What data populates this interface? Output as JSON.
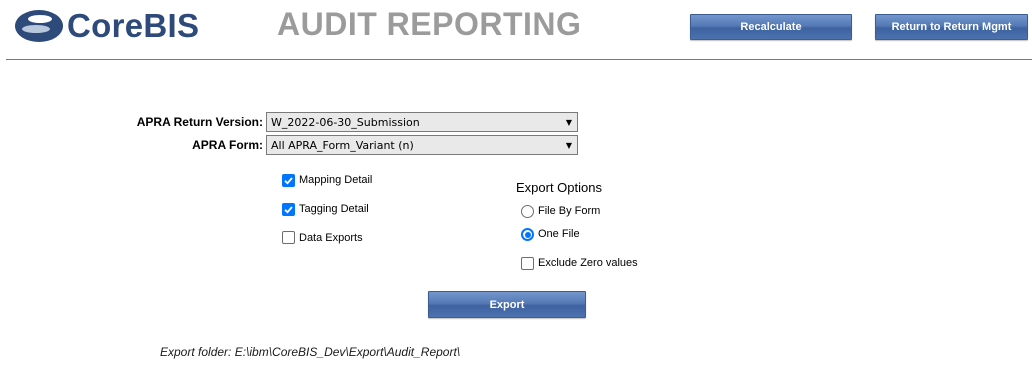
{
  "header": {
    "logo_text": "CoreBIS",
    "page_title": "AUDIT REPORTING",
    "recalculate_label": "Recalculate",
    "return_label": "Return to Return Mgmt"
  },
  "form": {
    "version_label": "APRA Return Version:",
    "version_value": "W_2022-06-30_Submission",
    "form_label": "APRA Form:",
    "form_value": "All APRA_Form_Variant (n)"
  },
  "detail_options": [
    {
      "label": "Mapping Detail",
      "checked": true
    },
    {
      "label": "Tagging Detail",
      "checked": true
    },
    {
      "label": "Data Exports",
      "checked": false
    }
  ],
  "export_options": {
    "title": "Export Options",
    "radios": [
      {
        "label": "File By Form",
        "selected": false
      },
      {
        "label": "One File",
        "selected": true
      }
    ],
    "exclude_zero": {
      "label": "Exclude Zero values",
      "checked": false
    }
  },
  "export_button_label": "Export",
  "export_folder_text": "Export folder: E:\\ibm\\CoreBIS_Dev\\Export\\Audit_Report\\",
  "colors": {
    "brand": "#2d4a7a",
    "button": "#4c72b0",
    "title_gray": "#9b9b9b",
    "check_blue": "#0075ff"
  }
}
